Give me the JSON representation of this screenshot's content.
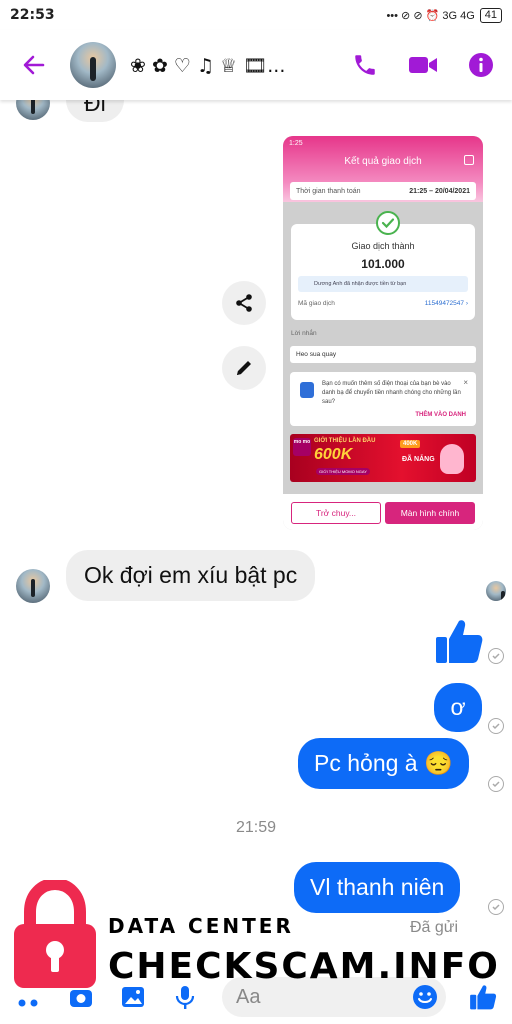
{
  "status_bar": {
    "time": "22:53",
    "icons_text": "••• ⊘ ⊘ ⏰ 3G 4G",
    "battery": "41"
  },
  "header": {
    "contact_name": "❀ ✿ ♡ ♫ ♕ 🎞...",
    "colors": {
      "accent": "#a11ad6"
    }
  },
  "messages": {
    "partial_top_text": "Đi",
    "shared_screenshot": {
      "clock": "1:25",
      "title": "Kết quả giao dịch",
      "time_label": "Thời gian thanh toán",
      "time_value": "21:25 – 20/04/2021",
      "status": "Giao dịch thành",
      "amount": "101.000",
      "note": "Dương Anh đã nhận được tiền từ bạn",
      "code_label": "Mã giao dịch",
      "code_value": "11549472547 ›",
      "message_label": "Lời nhắn",
      "message_value": "Heo sua quay",
      "contact_prompt": "Bạn có muốn thêm số điện thoại của bạn bè vào danh bạ để chuyển tiền nhanh chóng cho những lần sau?",
      "contact_close": "×",
      "contact_button": "THÊM VÀO DANH",
      "banner_brand": "mo mo",
      "banner_line1": "GIỚI THIỆU LẦN ĐẦU",
      "banner_amount": "600K",
      "banner_sub": "GIỚI THIỆU MOMO NGAY",
      "banner_tag": "400K",
      "banner_tag2": "ĐÃ NẮNG",
      "btn_back": "Trở chuy...",
      "btn_main": "Màn hình chính"
    },
    "incoming_1": "Ok đợi em xíu bật pc",
    "outgoing_thumbs": "👍",
    "outgoing_1": "ơ",
    "outgoing_2": "Pc hỏng à 😔",
    "timestamp": "21:59",
    "outgoing_3": "Vl thanh niên",
    "sent_status": "Đã gửi"
  },
  "composer": {
    "placeholder": "Aa"
  },
  "watermark": {
    "line1": "DATA CENTER",
    "line2": "CHECKSCAM.INFO"
  }
}
